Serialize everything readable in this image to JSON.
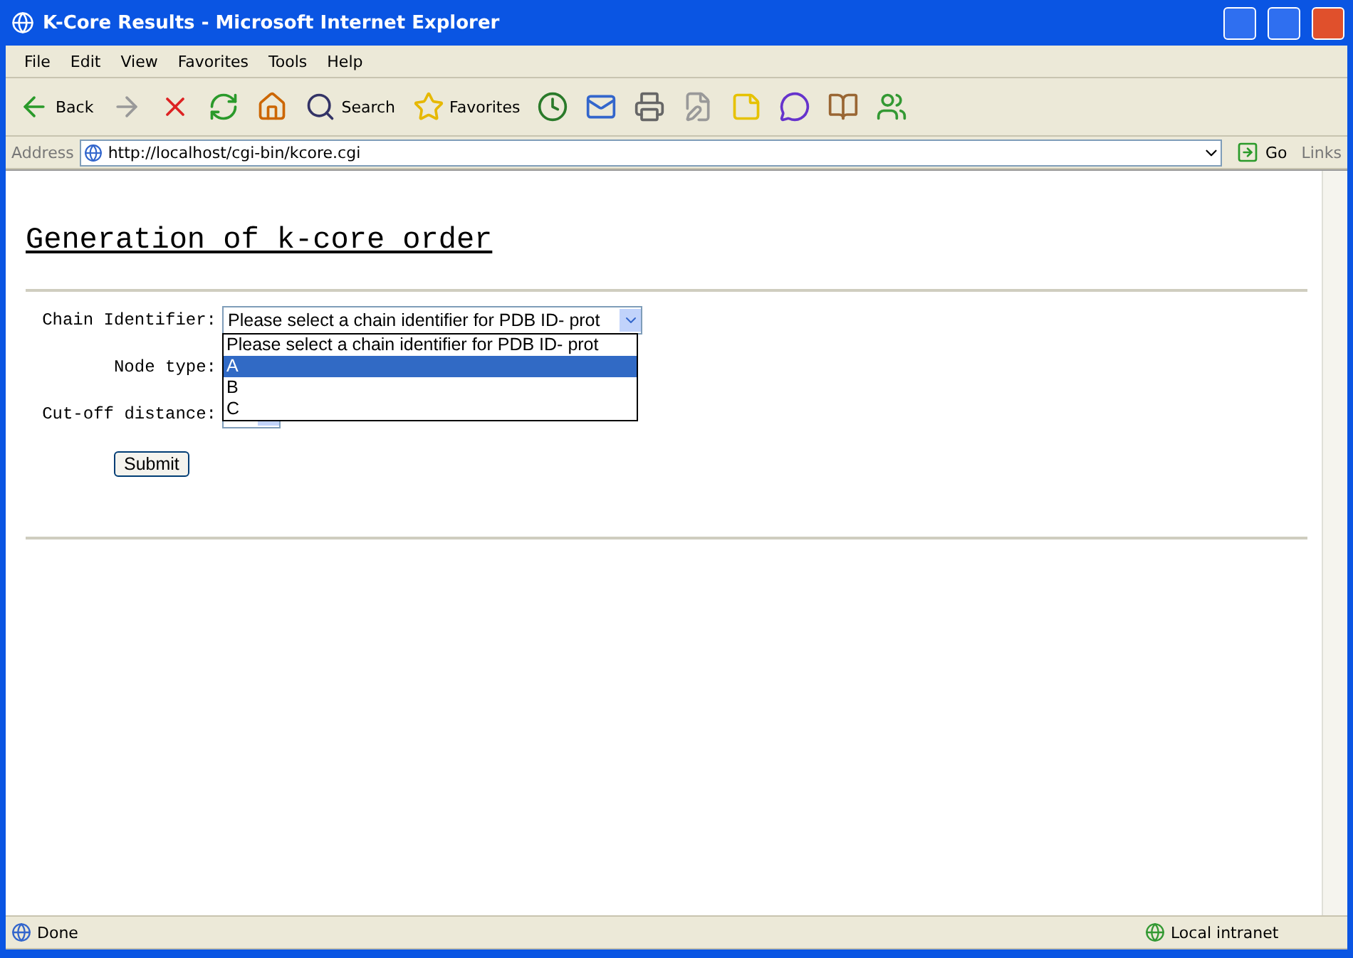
{
  "window": {
    "title": "K-Core Results - Microsoft Internet Explorer"
  },
  "menu": [
    "File",
    "Edit",
    "View",
    "Favorites",
    "Tools",
    "Help"
  ],
  "toolbar": [
    {
      "kind": "back",
      "label": "Back"
    },
    {
      "kind": "forward"
    },
    {
      "kind": "stop"
    },
    {
      "kind": "refresh"
    },
    {
      "kind": "home"
    },
    {
      "kind": "search",
      "label": "Search"
    },
    {
      "kind": "favorites",
      "label": "Favorites"
    },
    {
      "kind": "history"
    },
    {
      "kind": "mail"
    },
    {
      "kind": "print"
    },
    {
      "kind": "edit"
    },
    {
      "kind": "note"
    },
    {
      "kind": "messenger"
    },
    {
      "kind": "research"
    },
    {
      "kind": "people"
    }
  ],
  "address": {
    "label": "Address",
    "value": "http://localhost/cgi-bin/kcore.cgi",
    "go": "Go",
    "links": "Links"
  },
  "page": {
    "heading": "Generation of k-core order",
    "fields": [
      {
        "label": "Chain Identifier:",
        "value": "Please select a chain identifier for PDB ID- prot"
      },
      {
        "label": "Node type:"
      },
      {
        "label": "Cut-off distance:"
      }
    ],
    "options": [
      {
        "label": "Please select a chain identifier for PDB ID- prot",
        "selected": false
      },
      {
        "label": "A",
        "selected": true
      },
      {
        "label": "B",
        "selected": false
      },
      {
        "label": "C",
        "selected": false
      }
    ],
    "submit": "Submit"
  },
  "status_bar": {
    "text": "Done",
    "zone": "Local intranet"
  }
}
